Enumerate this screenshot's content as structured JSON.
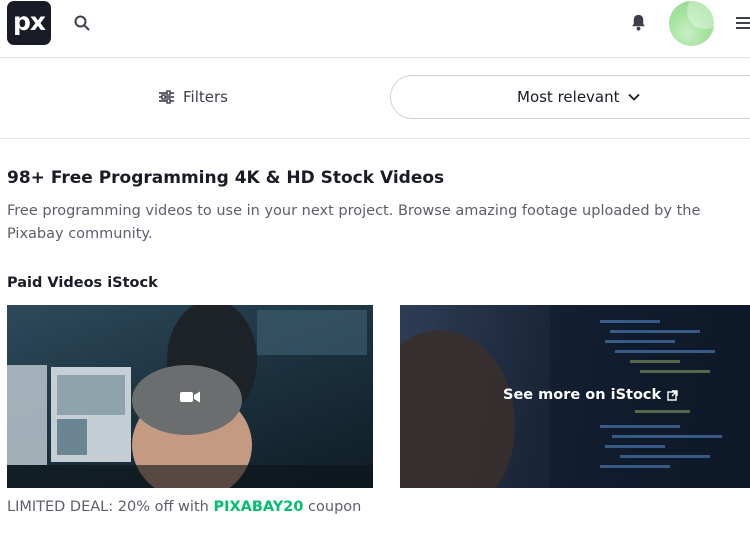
{
  "header": {
    "logo_text": "px",
    "icons": [
      "search-icon",
      "bell-icon",
      "avatar",
      "menu-icon"
    ]
  },
  "filterbar": {
    "filters_label": "Filters",
    "sort_label": "Most relevant"
  },
  "main": {
    "title": "98+ Free Programming 4K & HD Stock Videos",
    "description": "Free programming videos to use in your next project. Browse amazing footage uploaded by the Pixabay community.",
    "section_title": "Paid Videos iStock",
    "istock_link_label": "See more on iStock",
    "deal_prefix": "LIMITED DEAL: 20% off with ",
    "deal_code": "PIXABAY20",
    "deal_suffix": " coupon"
  },
  "colors": {
    "brand_dark": "#191b26",
    "accent_green": "#02be6e",
    "muted_text": "#5c5e6a"
  }
}
